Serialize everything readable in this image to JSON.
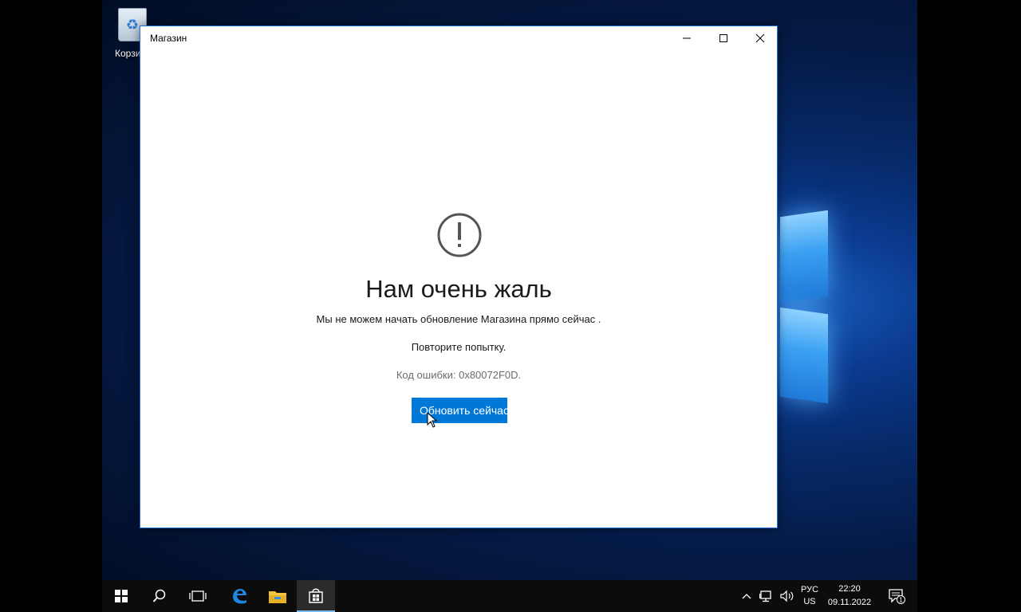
{
  "window": {
    "title": "Магазин"
  },
  "error": {
    "heading": "Нам очень жаль",
    "message": "Мы не можем начать обновление Магазина прямо сейчас .",
    "retry": "Повторите попытку.",
    "code": "Код ошибки: 0x80072F0D.",
    "button_label": "Обновить сейчас"
  },
  "desktop": {
    "recycle_bin_label": "Корзина"
  },
  "taskbar": {
    "icons": [
      "windows-start-icon",
      "search-icon",
      "task-view-icon",
      "edge-icon",
      "file-explorer-icon",
      "store-icon"
    ],
    "language_top": "РУС",
    "language_bottom": "US",
    "time": "22:20",
    "date": "09.11.2022",
    "notification_count": "1"
  },
  "colors": {
    "accent": "#0078d7",
    "titlebar_border": "#1f6fd2",
    "taskbar": "#0c0c0c"
  }
}
